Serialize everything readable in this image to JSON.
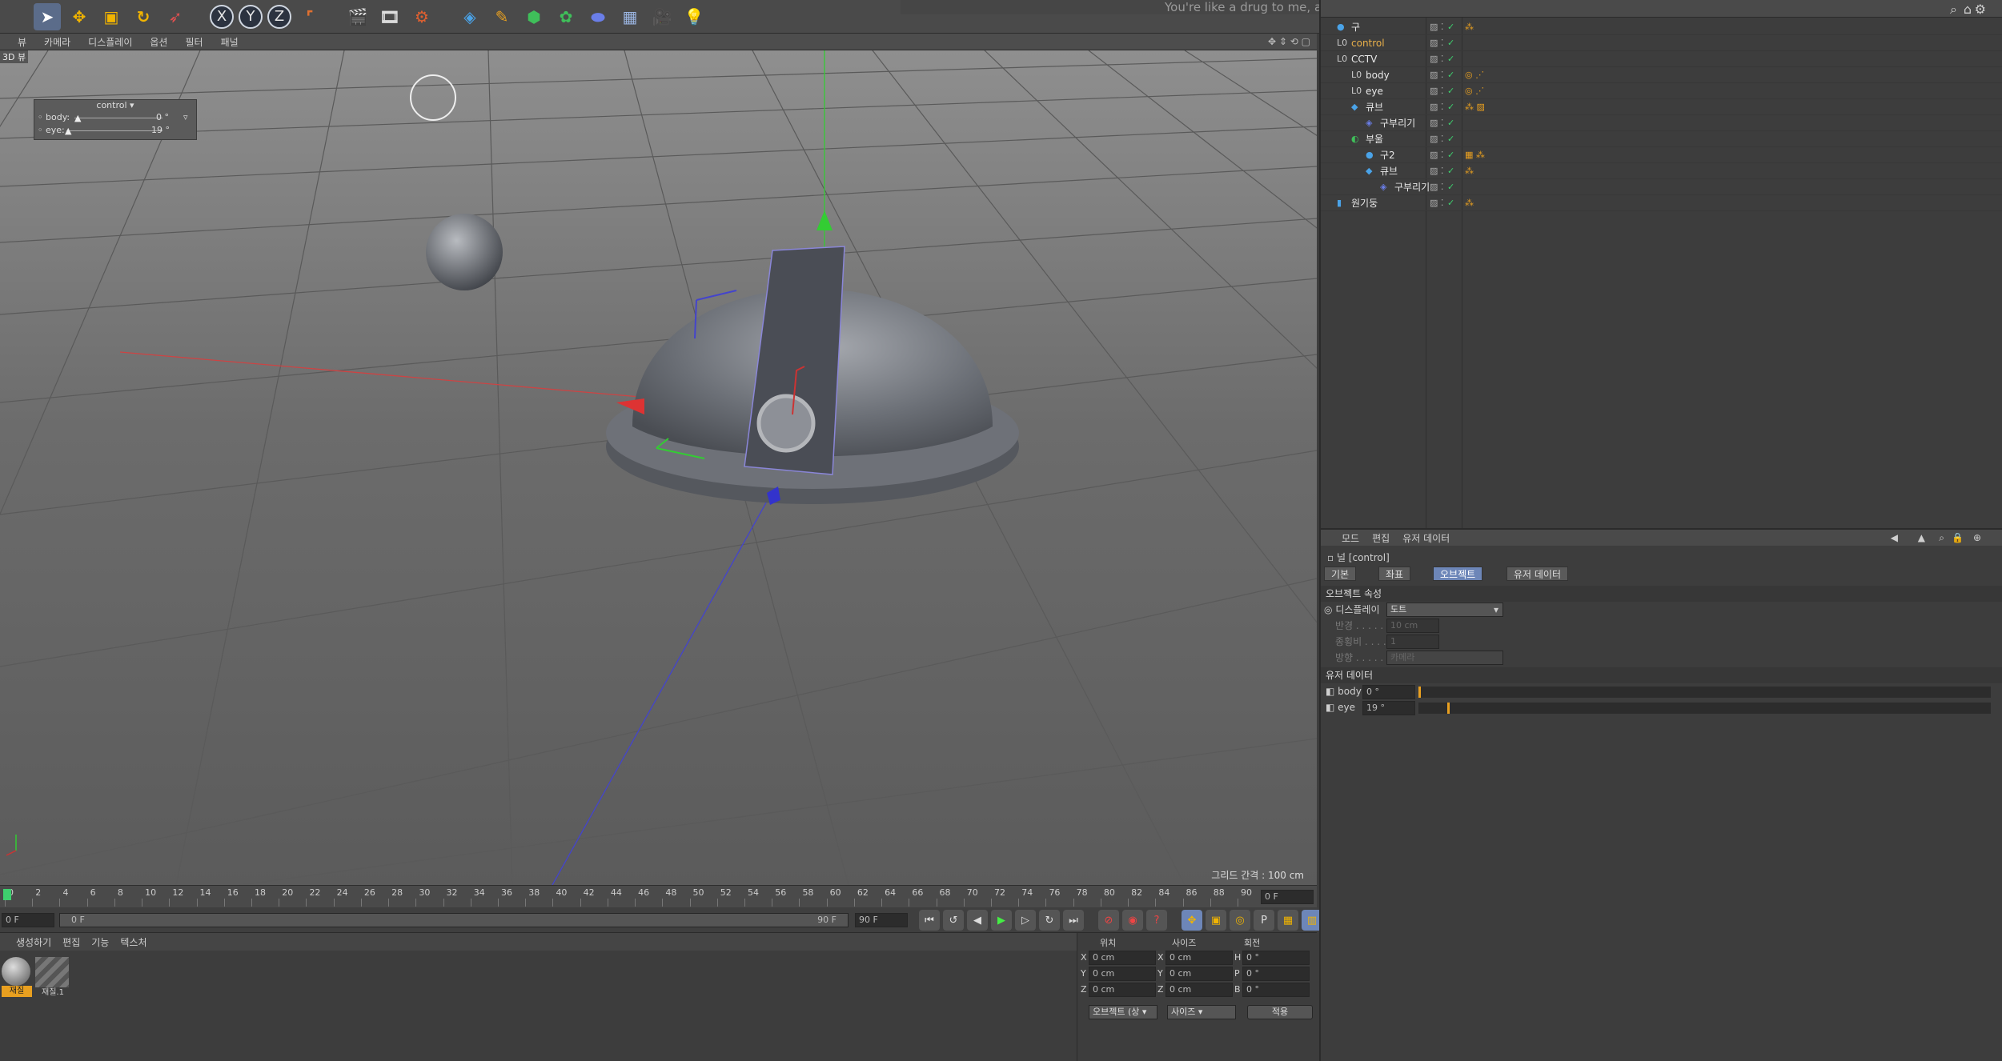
{
  "song_bar": "You're like a drug to me, a luxury, my sugar and gold I want the good life",
  "toolbar": {
    "icons": [
      "select-arrow",
      "move",
      "scale",
      "rotate",
      "live-select",
      "x-axis",
      "y-axis",
      "z-axis",
      "world-coord",
      "render-view",
      "render-picture",
      "render-settings",
      "cube",
      "pen",
      "subdivision",
      "generator",
      "deformer",
      "floor",
      "camera",
      "light"
    ],
    "axes": [
      "X",
      "Y",
      "Z"
    ]
  },
  "viewport": {
    "menu": [
      "뷰",
      "카메라",
      "디스플레이",
      "옵션",
      "필터",
      "패널"
    ],
    "label": "3D 뷰",
    "grid_label": "그리드 간격 : 100 cm",
    "hud": {
      "title": "control",
      "rows": [
        {
          "label": "body",
          "value": "0 °",
          "fill": 0.0
        },
        {
          "label": "eye",
          "value": "19 °",
          "fill": 0.05
        }
      ]
    }
  },
  "timeline": {
    "ticks": [
      "0",
      "2",
      "4",
      "6",
      "8",
      "10",
      "12",
      "14",
      "16",
      "18",
      "20",
      "22",
      "24",
      "26",
      "28",
      "30",
      "32",
      "34",
      "36",
      "38",
      "40",
      "42",
      "44",
      "46",
      "48",
      "50",
      "52",
      "54",
      "56",
      "58",
      "60",
      "62",
      "64",
      "66",
      "68",
      "70",
      "72",
      "74",
      "76",
      "78",
      "80",
      "82",
      "84",
      "86",
      "88",
      "90"
    ],
    "current_frame": "0 F",
    "start": "0 F",
    "range_start": "0 F",
    "range_end": "90 F",
    "end": "90 F"
  },
  "material": {
    "menu": [
      "생성하기",
      "편집",
      "기능",
      "텍스처"
    ],
    "items": [
      "재질",
      "재질.1"
    ]
  },
  "coords": {
    "headers": [
      "위치",
      "사이즈",
      "회전"
    ],
    "rows": [
      {
        "a": "X",
        "pos": "0 cm",
        "b": "X",
        "size": "0 cm",
        "c": "H",
        "rot": "0 °"
      },
      {
        "a": "Y",
        "pos": "0 cm",
        "b": "Y",
        "size": "0 cm",
        "c": "P",
        "rot": "0 °"
      },
      {
        "a": "Z",
        "pos": "0 cm",
        "b": "Z",
        "size": "0 cm",
        "c": "B",
        "rot": "0 °"
      }
    ],
    "mode_select": "오브젝트 (상",
    "size_select": "사이즈",
    "apply": "적용"
  },
  "objects": [
    {
      "name": "구",
      "type": "sphere",
      "indent": 0,
      "color": "#e8e8e8",
      "tag": "dots"
    },
    {
      "name": "control",
      "type": "null",
      "indent": 0,
      "color": "#e9b04a",
      "tag": ""
    },
    {
      "name": "CCTV",
      "type": "null",
      "indent": 0,
      "color": "#e8e8e8",
      "tag": ""
    },
    {
      "name": "body",
      "type": "null",
      "indent": 1,
      "color": "#e8e8e8",
      "tag": "xpresso"
    },
    {
      "name": "eye",
      "type": "null",
      "indent": 1,
      "color": "#e8e8e8",
      "tag": "xpresso"
    },
    {
      "name": "큐브",
      "type": "cube",
      "indent": 1,
      "color": "#e8e8e8",
      "tag": "material"
    },
    {
      "name": "구부리기",
      "type": "bend",
      "indent": 2,
      "color": "#e8e8e8",
      "tag": ""
    },
    {
      "name": "부울",
      "type": "boole",
      "indent": 1,
      "color": "#e8e8e8",
      "tag": ""
    },
    {
      "name": "구2",
      "type": "sphere",
      "indent": 2,
      "color": "#e8e8e8",
      "tag": "checker"
    },
    {
      "name": "큐브",
      "type": "cube",
      "indent": 2,
      "color": "#e8e8e8",
      "tag": "dots"
    },
    {
      "name": "구부리기",
      "type": "bend",
      "indent": 3,
      "color": "#e8e8e8",
      "tag": ""
    },
    {
      "name": "원기둥",
      "type": "cylinder",
      "indent": 0,
      "color": "#e8e8e8",
      "tag": "dots"
    }
  ],
  "attributes": {
    "menu": [
      "모드",
      "편집",
      "유저 데이터"
    ],
    "object_title": "널 [control]",
    "tabs": [
      "기본",
      "좌표",
      "오브젝트",
      "유저 데이터"
    ],
    "active_tab": 2,
    "section_object": "오브젝트 속성",
    "display_label": "디스플레이",
    "display_value": "도트",
    "radius_label": "반경 . . . . . .",
    "radius_value": "10 cm",
    "aspect_label": "종횡비 . . . . .",
    "aspect_value": "1",
    "orientation_label": "방향 . . . . . .",
    "orientation_value": "카메라",
    "section_user": "유저 데이터",
    "user_rows": [
      {
        "label": "body",
        "value": "0 °",
        "fill": 0.0
      },
      {
        "label": "eye",
        "value": "19 °",
        "fill": 0.05
      }
    ]
  },
  "accent_colors": {
    "selection": "#6d86b8",
    "active_object": "#e9b04a",
    "timeline_marker": "#3ecf6e"
  }
}
